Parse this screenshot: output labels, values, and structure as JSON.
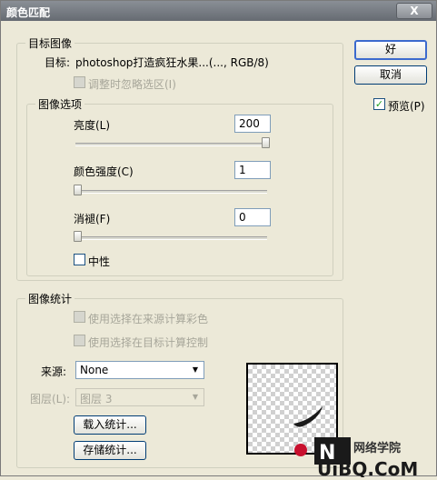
{
  "window": {
    "title": "颜色匹配",
    "close_label": "X"
  },
  "target_image": {
    "legend": "目标图像",
    "target_label": "目标:",
    "target_value": "photoshop打造疯狂水果...(..., RGB/8)",
    "ignore_selection_label": "调整时忽略选区(I)"
  },
  "image_options": {
    "legend": "图像选项",
    "luminance": {
      "label": "亮度(L)",
      "value": "200",
      "slider_fraction": 1.0
    },
    "color_intensity": {
      "label": "颜色强度(C)",
      "value": "1",
      "slider_fraction": 0.0
    },
    "fade": {
      "label": "消褪(F)",
      "value": "0",
      "slider_fraction": 0.0
    },
    "neutralize_label": "中性"
  },
  "image_statistics": {
    "legend": "图像统计",
    "use_source_selection_label": "使用选择在来源计算彩色",
    "use_target_selection_label": "使用选择在目标计算控制",
    "source_label": "来源:",
    "source_value": "None",
    "layer_label": "图层(L):",
    "layer_value": "图层 3",
    "load_stats_label": "载入统计...",
    "save_stats_label": "存储统计..."
  },
  "buttons": {
    "ok_label": "好",
    "cancel_label": "取消",
    "preview_label": "预览(P)",
    "preview_checked": true
  },
  "watermark": {
    "brand_cn": "网络学院",
    "brand_en": "UiBQ.CoM"
  }
}
